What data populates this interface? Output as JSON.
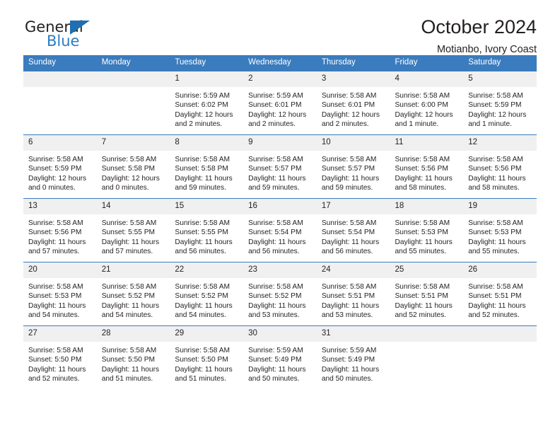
{
  "logo": {
    "word_top": "General",
    "word_bottom": "Blue",
    "triangle_color": "#1f6fb2",
    "blue_color": "#2b7cc4"
  },
  "header": {
    "title": "October 2024",
    "subtitle": "Motianbo, Ivory Coast",
    "accent_color": "#3a7cbe"
  },
  "calendar": {
    "weekday_headers": [
      "Sunday",
      "Monday",
      "Tuesday",
      "Wednesday",
      "Thursday",
      "Friday",
      "Saturday"
    ],
    "weeks": [
      [
        {
          "day": "",
          "lines": []
        },
        {
          "day": "",
          "lines": []
        },
        {
          "day": "1",
          "lines": [
            "Sunrise: 5:59 AM",
            "Sunset: 6:02 PM",
            "Daylight: 12 hours",
            "and 2 minutes."
          ]
        },
        {
          "day": "2",
          "lines": [
            "Sunrise: 5:59 AM",
            "Sunset: 6:01 PM",
            "Daylight: 12 hours",
            "and 2 minutes."
          ]
        },
        {
          "day": "3",
          "lines": [
            "Sunrise: 5:58 AM",
            "Sunset: 6:01 PM",
            "Daylight: 12 hours",
            "and 2 minutes."
          ]
        },
        {
          "day": "4",
          "lines": [
            "Sunrise: 5:58 AM",
            "Sunset: 6:00 PM",
            "Daylight: 12 hours",
            "and 1 minute."
          ]
        },
        {
          "day": "5",
          "lines": [
            "Sunrise: 5:58 AM",
            "Sunset: 5:59 PM",
            "Daylight: 12 hours",
            "and 1 minute."
          ]
        }
      ],
      [
        {
          "day": "6",
          "lines": [
            "Sunrise: 5:58 AM",
            "Sunset: 5:59 PM",
            "Daylight: 12 hours",
            "and 0 minutes."
          ]
        },
        {
          "day": "7",
          "lines": [
            "Sunrise: 5:58 AM",
            "Sunset: 5:58 PM",
            "Daylight: 12 hours",
            "and 0 minutes."
          ]
        },
        {
          "day": "8",
          "lines": [
            "Sunrise: 5:58 AM",
            "Sunset: 5:58 PM",
            "Daylight: 11 hours",
            "and 59 minutes."
          ]
        },
        {
          "day": "9",
          "lines": [
            "Sunrise: 5:58 AM",
            "Sunset: 5:57 PM",
            "Daylight: 11 hours",
            "and 59 minutes."
          ]
        },
        {
          "day": "10",
          "lines": [
            "Sunrise: 5:58 AM",
            "Sunset: 5:57 PM",
            "Daylight: 11 hours",
            "and 59 minutes."
          ]
        },
        {
          "day": "11",
          "lines": [
            "Sunrise: 5:58 AM",
            "Sunset: 5:56 PM",
            "Daylight: 11 hours",
            "and 58 minutes."
          ]
        },
        {
          "day": "12",
          "lines": [
            "Sunrise: 5:58 AM",
            "Sunset: 5:56 PM",
            "Daylight: 11 hours",
            "and 58 minutes."
          ]
        }
      ],
      [
        {
          "day": "13",
          "lines": [
            "Sunrise: 5:58 AM",
            "Sunset: 5:56 PM",
            "Daylight: 11 hours",
            "and 57 minutes."
          ]
        },
        {
          "day": "14",
          "lines": [
            "Sunrise: 5:58 AM",
            "Sunset: 5:55 PM",
            "Daylight: 11 hours",
            "and 57 minutes."
          ]
        },
        {
          "day": "15",
          "lines": [
            "Sunrise: 5:58 AM",
            "Sunset: 5:55 PM",
            "Daylight: 11 hours",
            "and 56 minutes."
          ]
        },
        {
          "day": "16",
          "lines": [
            "Sunrise: 5:58 AM",
            "Sunset: 5:54 PM",
            "Daylight: 11 hours",
            "and 56 minutes."
          ]
        },
        {
          "day": "17",
          "lines": [
            "Sunrise: 5:58 AM",
            "Sunset: 5:54 PM",
            "Daylight: 11 hours",
            "and 56 minutes."
          ]
        },
        {
          "day": "18",
          "lines": [
            "Sunrise: 5:58 AM",
            "Sunset: 5:53 PM",
            "Daylight: 11 hours",
            "and 55 minutes."
          ]
        },
        {
          "day": "19",
          "lines": [
            "Sunrise: 5:58 AM",
            "Sunset: 5:53 PM",
            "Daylight: 11 hours",
            "and 55 minutes."
          ]
        }
      ],
      [
        {
          "day": "20",
          "lines": [
            "Sunrise: 5:58 AM",
            "Sunset: 5:53 PM",
            "Daylight: 11 hours",
            "and 54 minutes."
          ]
        },
        {
          "day": "21",
          "lines": [
            "Sunrise: 5:58 AM",
            "Sunset: 5:52 PM",
            "Daylight: 11 hours",
            "and 54 minutes."
          ]
        },
        {
          "day": "22",
          "lines": [
            "Sunrise: 5:58 AM",
            "Sunset: 5:52 PM",
            "Daylight: 11 hours",
            "and 54 minutes."
          ]
        },
        {
          "day": "23",
          "lines": [
            "Sunrise: 5:58 AM",
            "Sunset: 5:52 PM",
            "Daylight: 11 hours",
            "and 53 minutes."
          ]
        },
        {
          "day": "24",
          "lines": [
            "Sunrise: 5:58 AM",
            "Sunset: 5:51 PM",
            "Daylight: 11 hours",
            "and 53 minutes."
          ]
        },
        {
          "day": "25",
          "lines": [
            "Sunrise: 5:58 AM",
            "Sunset: 5:51 PM",
            "Daylight: 11 hours",
            "and 52 minutes."
          ]
        },
        {
          "day": "26",
          "lines": [
            "Sunrise: 5:58 AM",
            "Sunset: 5:51 PM",
            "Daylight: 11 hours",
            "and 52 minutes."
          ]
        }
      ],
      [
        {
          "day": "27",
          "lines": [
            "Sunrise: 5:58 AM",
            "Sunset: 5:50 PM",
            "Daylight: 11 hours",
            "and 52 minutes."
          ]
        },
        {
          "day": "28",
          "lines": [
            "Sunrise: 5:58 AM",
            "Sunset: 5:50 PM",
            "Daylight: 11 hours",
            "and 51 minutes."
          ]
        },
        {
          "day": "29",
          "lines": [
            "Sunrise: 5:58 AM",
            "Sunset: 5:50 PM",
            "Daylight: 11 hours",
            "and 51 minutes."
          ]
        },
        {
          "day": "30",
          "lines": [
            "Sunrise: 5:59 AM",
            "Sunset: 5:49 PM",
            "Daylight: 11 hours",
            "and 50 minutes."
          ]
        },
        {
          "day": "31",
          "lines": [
            "Sunrise: 5:59 AM",
            "Sunset: 5:49 PM",
            "Daylight: 11 hours",
            "and 50 minutes."
          ]
        },
        {
          "day": "",
          "lines": []
        },
        {
          "day": "",
          "lines": []
        }
      ]
    ]
  }
}
